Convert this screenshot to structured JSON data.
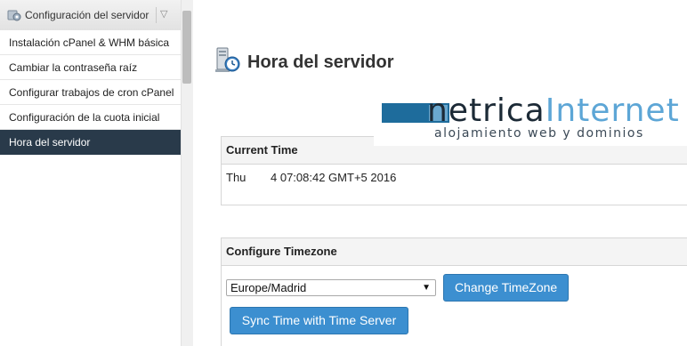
{
  "sidebar": {
    "header_title": "Configuración del servidor",
    "header_toggle": "▽",
    "items": [
      {
        "label": "Instalación cPanel & WHM básica"
      },
      {
        "label": "Cambiar la contraseña raíz"
      },
      {
        "label": "Configurar trabajos de cron cPanel"
      },
      {
        "label": "Configuración de la cuota inicial"
      },
      {
        "label": "Hora del servidor",
        "active": true
      }
    ]
  },
  "page": {
    "title": "Hora del servidor",
    "title_icon": "server-clock-icon"
  },
  "watermark": {
    "brand_part1": "netrica",
    "brand_part2": "Internet",
    "tagline": "alojamiento web y dominios"
  },
  "current_time": {
    "heading": "Current Time",
    "day": "Thu",
    "value": "4 07:08:42 GMT+5 2016"
  },
  "timezone": {
    "heading": "Configure Timezone",
    "selected": "Europe/Madrid",
    "change_button": "Change TimeZone",
    "sync_button": "Sync Time with Time Server"
  },
  "colors": {
    "active_item_bg": "#293a4a",
    "button_bg": "#3c8fd0",
    "brand_dark": "#1c2a36",
    "brand_accent": "#5da6d6"
  }
}
